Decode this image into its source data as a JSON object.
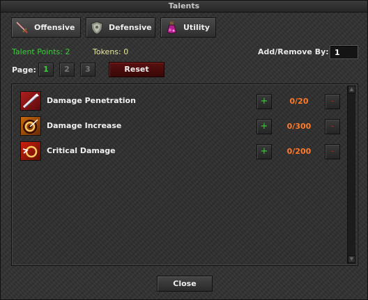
{
  "window": {
    "title": "Talents"
  },
  "tabs": [
    {
      "label": "Offensive",
      "icon": "sword-icon"
    },
    {
      "label": "Defensive",
      "icon": "shield-icon"
    },
    {
      "label": "Utility",
      "icon": "potion-icon"
    }
  ],
  "status": {
    "talent_points_label": "Talent Points: 2",
    "tokens_label": "Tokens: 0",
    "add_remove_label": "Add/Remove By:",
    "add_remove_value": "1"
  },
  "pagination": {
    "label": "Page:",
    "pages": [
      "1",
      "2",
      "3"
    ],
    "current": "1"
  },
  "reset_label": "Reset",
  "talents": [
    {
      "name": "Damage Penetration",
      "count": "0/20",
      "icon": "arrow-pierce-icon"
    },
    {
      "name": "Damage Increase",
      "count": "0/300",
      "icon": "target-icon"
    },
    {
      "name": "Critical Damage",
      "count": "0/200",
      "icon": "crit-ring-icon"
    }
  ],
  "plus_label": "+",
  "minus_label": "-",
  "close_label": "Close",
  "colors": {
    "green": "#3ccc3c",
    "orange": "#ff7a2a",
    "reset_red": "#5a1010",
    "minus_red": "#b02020"
  }
}
